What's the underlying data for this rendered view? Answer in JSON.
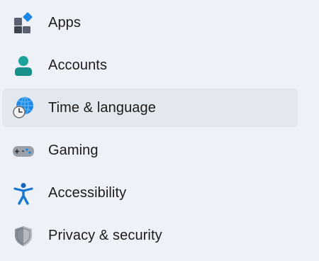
{
  "nav": {
    "items": [
      {
        "label": "Apps",
        "icon": "apps-icon",
        "selected": false
      },
      {
        "label": "Accounts",
        "icon": "accounts-icon",
        "selected": false
      },
      {
        "label": "Time & language",
        "icon": "time-language-icon",
        "selected": true
      },
      {
        "label": "Gaming",
        "icon": "gaming-icon",
        "selected": false
      },
      {
        "label": "Accessibility",
        "icon": "accessibility-icon",
        "selected": false
      },
      {
        "label": "Privacy & security",
        "icon": "shield-icon",
        "selected": false
      }
    ]
  },
  "colors": {
    "background": "#eef2f8",
    "selected_background": "#e3e7ee",
    "text": "#1b1b1b",
    "accent_blue": "#1e88e5",
    "accent_teal": "#1ba39c"
  }
}
